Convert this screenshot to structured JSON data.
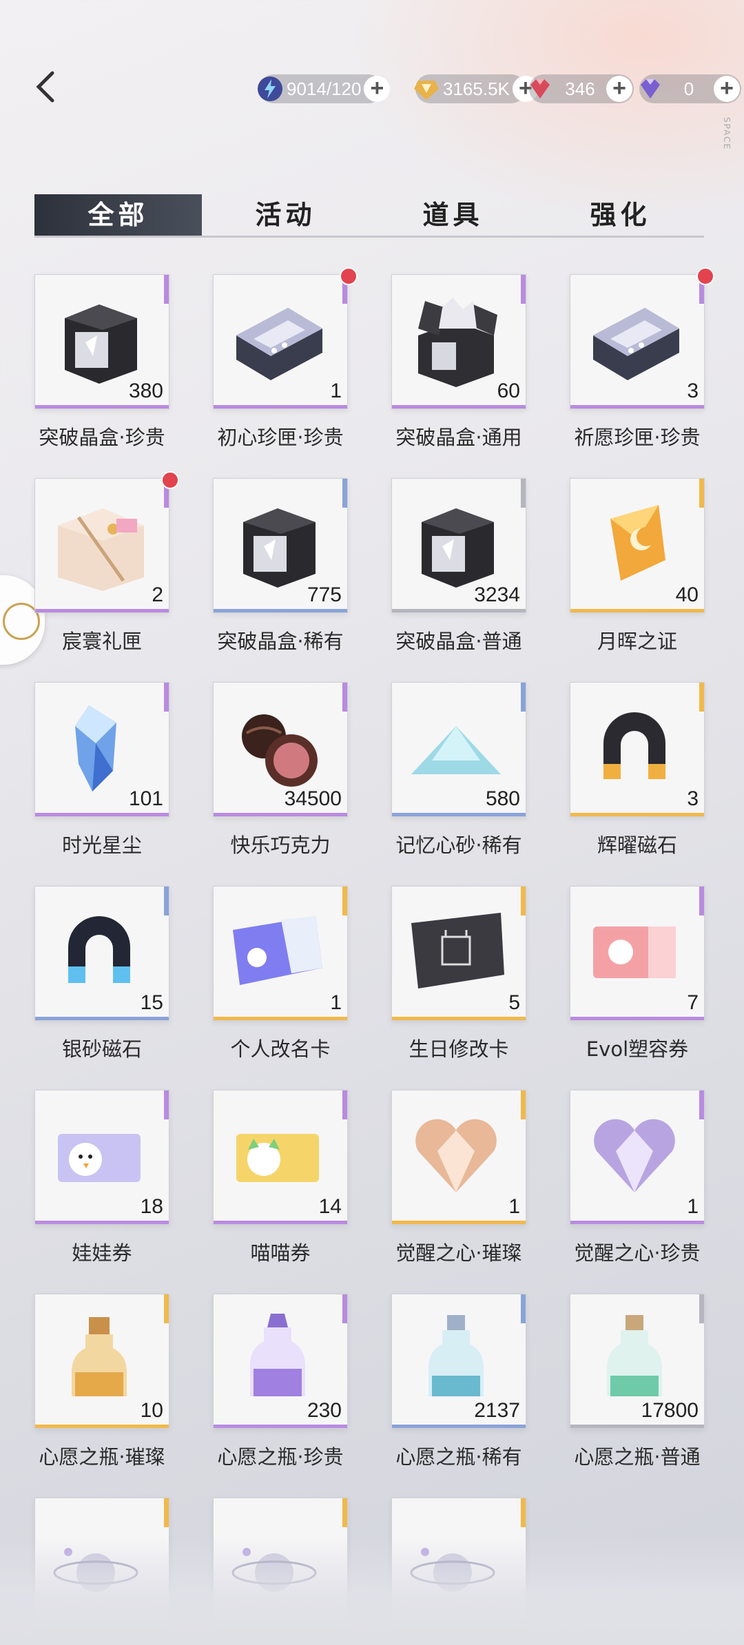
{
  "resources": [
    {
      "icon": "lightning-icon",
      "value": "9014/120"
    },
    {
      "icon": "gold-coin-icon",
      "value": "3165.5K"
    },
    {
      "icon": "red-diamond-icon",
      "value": "346"
    },
    {
      "icon": "purple-diamond-icon",
      "value": "0"
    }
  ],
  "side_text": "SPACE",
  "tabs": [
    {
      "label": "全部"
    },
    {
      "label": "活动"
    },
    {
      "label": "道具"
    },
    {
      "label": "强化"
    }
  ],
  "active_tab": "全部",
  "items": [
    {
      "name": "突破晶盒·珍贵",
      "count": "380",
      "rarity": "purple",
      "art": "black-box-icon",
      "badge": false
    },
    {
      "name": "初心珍匣·珍贵",
      "count": "1",
      "rarity": "purple",
      "art": "silver-box-icon",
      "badge": true
    },
    {
      "name": "突破晶盒·通用",
      "count": "60",
      "rarity": "purple",
      "art": "open-box-icon",
      "badge": false
    },
    {
      "name": "祈愿珍匣·珍贵",
      "count": "3",
      "rarity": "purple",
      "art": "silver-box-icon",
      "badge": true
    },
    {
      "name": "宸寰礼匣",
      "count": "2",
      "rarity": "purple",
      "art": "gift-box-icon",
      "badge": true
    },
    {
      "name": "突破晶盒·稀有",
      "count": "775",
      "rarity": "blue",
      "art": "black-box-icon",
      "badge": false
    },
    {
      "name": "突破晶盒·普通",
      "count": "3234",
      "rarity": "gray",
      "art": "black-box-icon",
      "badge": false
    },
    {
      "name": "月晖之证",
      "count": "40",
      "rarity": "gold",
      "art": "moon-crystal-icon",
      "badge": false
    },
    {
      "name": "时光星尘",
      "count": "101",
      "rarity": "purple",
      "art": "blue-crystal-icon",
      "badge": false
    },
    {
      "name": "快乐巧克力",
      "count": "34500",
      "rarity": "purple",
      "art": "chocolate-icon",
      "badge": false
    },
    {
      "name": "记忆心砂·稀有",
      "count": "580",
      "rarity": "blue",
      "art": "sand-pile-icon",
      "badge": false
    },
    {
      "name": "辉曜磁石",
      "count": "3",
      "rarity": "gold",
      "art": "gold-magnet-icon",
      "badge": false
    },
    {
      "name": "银砂磁石",
      "count": "15",
      "rarity": "blue",
      "art": "blue-magnet-icon",
      "badge": false
    },
    {
      "name": "个人改名卡",
      "count": "1",
      "rarity": "gold",
      "art": "rename-card-icon",
      "badge": false
    },
    {
      "name": "生日修改卡",
      "count": "5",
      "rarity": "gold",
      "art": "birthday-card-icon",
      "badge": false
    },
    {
      "name": "Evol塑容券",
      "count": "7",
      "rarity": "purple",
      "art": "evol-ticket-icon",
      "badge": false
    },
    {
      "name": "娃娃券",
      "count": "18",
      "rarity": "purple",
      "art": "doll-ticket-icon",
      "badge": false
    },
    {
      "name": "喵喵券",
      "count": "14",
      "rarity": "purple",
      "art": "cat-ticket-icon",
      "badge": false
    },
    {
      "name": "觉醒之心·璀璨",
      "count": "1",
      "rarity": "gold",
      "art": "gold-heart-icon",
      "badge": false
    },
    {
      "name": "觉醒之心·珍贵",
      "count": "1",
      "rarity": "purple",
      "art": "purple-heart-icon",
      "badge": false
    },
    {
      "name": "心愿之瓶·璀璨",
      "count": "10",
      "rarity": "gold",
      "art": "gold-bottle-icon",
      "badge": false
    },
    {
      "name": "心愿之瓶·珍贵",
      "count": "230",
      "rarity": "purple",
      "art": "purple-bottle-icon",
      "badge": false
    },
    {
      "name": "心愿之瓶·稀有",
      "count": "2137",
      "rarity": "blue",
      "art": "blue-bottle-icon",
      "badge": false
    },
    {
      "name": "心愿之瓶·普通",
      "count": "17800",
      "rarity": "gray",
      "art": "green-bottle-icon",
      "badge": false
    },
    {
      "name": "",
      "count": "",
      "rarity": "gold",
      "art": "planet-orb-icon",
      "badge": false
    },
    {
      "name": "",
      "count": "",
      "rarity": "gold",
      "art": "planet-orb-icon",
      "badge": false
    },
    {
      "name": "",
      "count": "",
      "rarity": "gold",
      "art": "planet-orb-icon",
      "badge": false
    }
  ],
  "colors": {
    "purple": "#b98be0",
    "blue": "#8aa3d8",
    "gray": "#b5b5bd",
    "gold": "#f1b94a",
    "active_tab": "#2c313b",
    "badge": "#e2434e"
  }
}
